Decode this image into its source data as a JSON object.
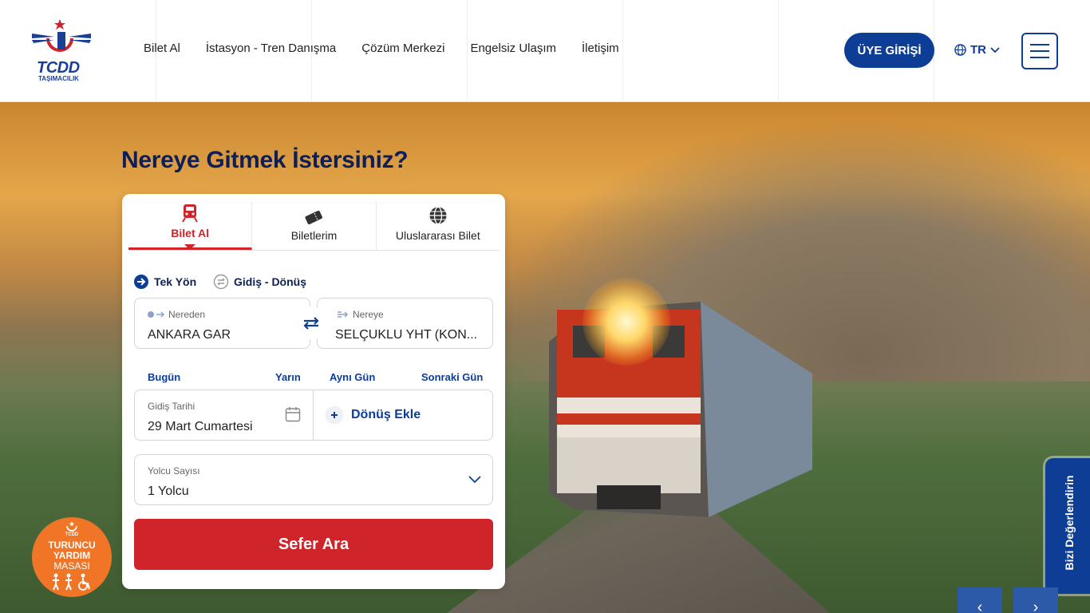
{
  "logo": {
    "text": "TCDD",
    "sub": "TAŞIMACILIK"
  },
  "nav": [
    "Bilet Al",
    "İstasyon - Tren Danışma",
    "Çözüm Merkezi",
    "Engelsiz Ulaşım",
    "İletişim"
  ],
  "header": {
    "member_label": "ÜYE GİRİŞİ",
    "language": "TR"
  },
  "hero": {
    "title": "Nereye Gitmek İstersiniz?"
  },
  "tabs": [
    {
      "label": "Bilet Al",
      "icon": "train-icon",
      "active": true
    },
    {
      "label": "Biletlerim",
      "icon": "ticket-icon",
      "active": false
    },
    {
      "label": "Uluslararası Bilet",
      "icon": "globe-icon",
      "active": false
    }
  ],
  "trip_type": {
    "one_way": "Tek Yön",
    "round_trip": "Gidiş - Dönüş",
    "selected": "one_way"
  },
  "from": {
    "label": "Nereden",
    "value": "ANKARA GAR"
  },
  "to": {
    "label": "Nereye",
    "value": "SELÇUKLU YHT (KON..."
  },
  "quick_dates": {
    "today": "Bugün",
    "tomorrow": "Yarın",
    "same_day": "Aynı Gün",
    "next_day": "Sonraki Gün"
  },
  "departure": {
    "label": "Gidiş Tarihi",
    "value": "29 Mart Cumartesi"
  },
  "return": {
    "label": "Dönüş Ekle"
  },
  "passengers": {
    "label": "Yolcu Sayısı",
    "value": "1 Yolcu"
  },
  "search": {
    "label": "Sefer Ara"
  },
  "helpdesk": {
    "line1": "TURUNCU",
    "line2": "YARDIM",
    "line3": "MASASI",
    "small": "TCDD"
  },
  "feedback": {
    "label": "Bizi Değerlendirin"
  },
  "colors": {
    "primary": "#0d3d95",
    "accent": "#d0242b",
    "orange": "#f07526"
  }
}
